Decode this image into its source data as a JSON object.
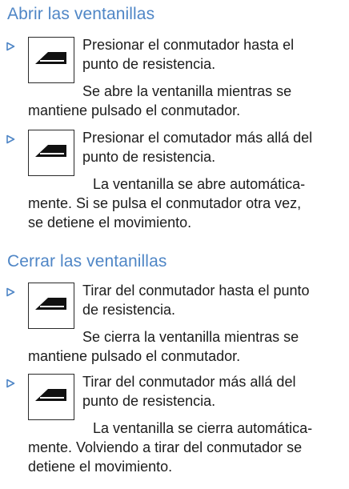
{
  "sections": [
    {
      "title": "Abrir las ventanillas",
      "items": [
        {
          "icon": "window-switch-icon",
          "step": [
            "Presionar el conmutador hasta el",
            "punto de resistencia."
          ],
          "result": [
            "Se abre la ventanilla mientras se",
            "mantiene pulsado el conmutador."
          ]
        },
        {
          "icon": "window-switch-icon",
          "step": [
            "Presionar el comutador más allá del",
            "punto de resistencia."
          ],
          "result": [
            "La ventanilla se abre automática-",
            "mente. Si se pulsa el conmutador otra vez,",
            "se detiene el movimiento."
          ]
        }
      ]
    },
    {
      "title": "Cerrar las ventanillas",
      "items": [
        {
          "icon": "window-switch-icon",
          "step": [
            "Tirar del conmutador hasta el punto",
            "de resistencia."
          ],
          "result": [
            "Se cierra la ventanilla mientras se",
            "mantiene pulsado el conmutador."
          ]
        },
        {
          "icon": "window-switch-icon",
          "step": [
            "Tirar del conmutador más allá del",
            "punto de resistencia."
          ],
          "result": [
            "La ventanilla se cierra automática-",
            "mente. Volviendo a tirar del conmutador se",
            "detiene el movimiento."
          ]
        }
      ]
    }
  ]
}
